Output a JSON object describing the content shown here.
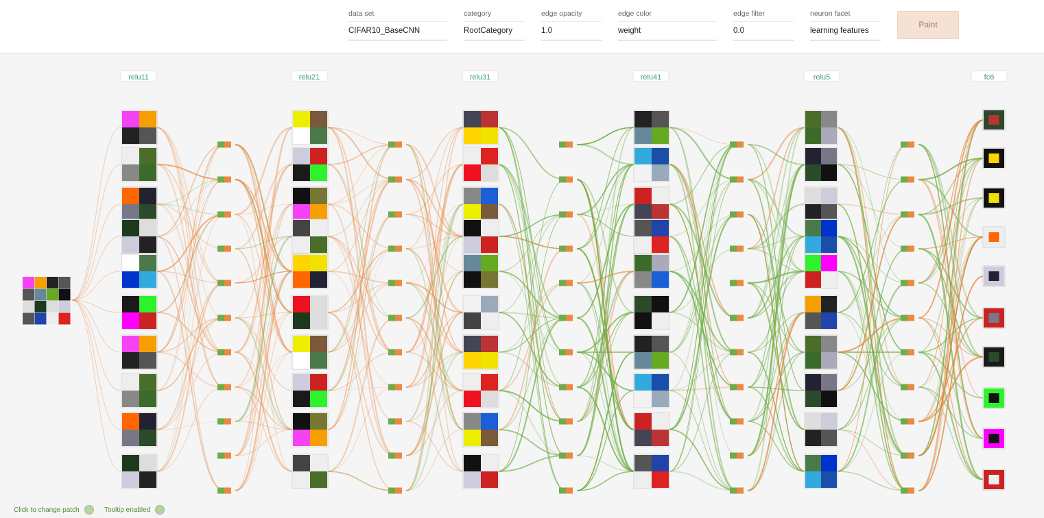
{
  "controls": [
    {
      "label": "data set",
      "value": "CIFAR10_BaseCNN"
    },
    {
      "label": "category",
      "value": "RootCategory"
    },
    {
      "label": "edge opacity",
      "value": "1.0"
    },
    {
      "label": "edge color",
      "value": "weight"
    },
    {
      "label": "edge filter",
      "value": "0.0"
    },
    {
      "label": "neuron facet",
      "value": "learning features"
    }
  ],
  "paint_label": "Paint",
  "layers": [
    "relu11",
    "relu21",
    "relu31",
    "relu41",
    "relu5",
    "fc6"
  ],
  "footer": {
    "patch_label": "Click to change patch",
    "tooltip_label": "Tooltip enabled"
  },
  "colors": {
    "edge_green": "#6fae45",
    "edge_orange": "#e8823a",
    "node_green": "#72ab4a",
    "node_orange": "#e98a44",
    "layer_label": "#3a9a86",
    "footer_text": "#4f8a3a"
  },
  "icons": {
    "toggle_patch": "status-dot",
    "toggle_tooltip": "status-dot"
  }
}
